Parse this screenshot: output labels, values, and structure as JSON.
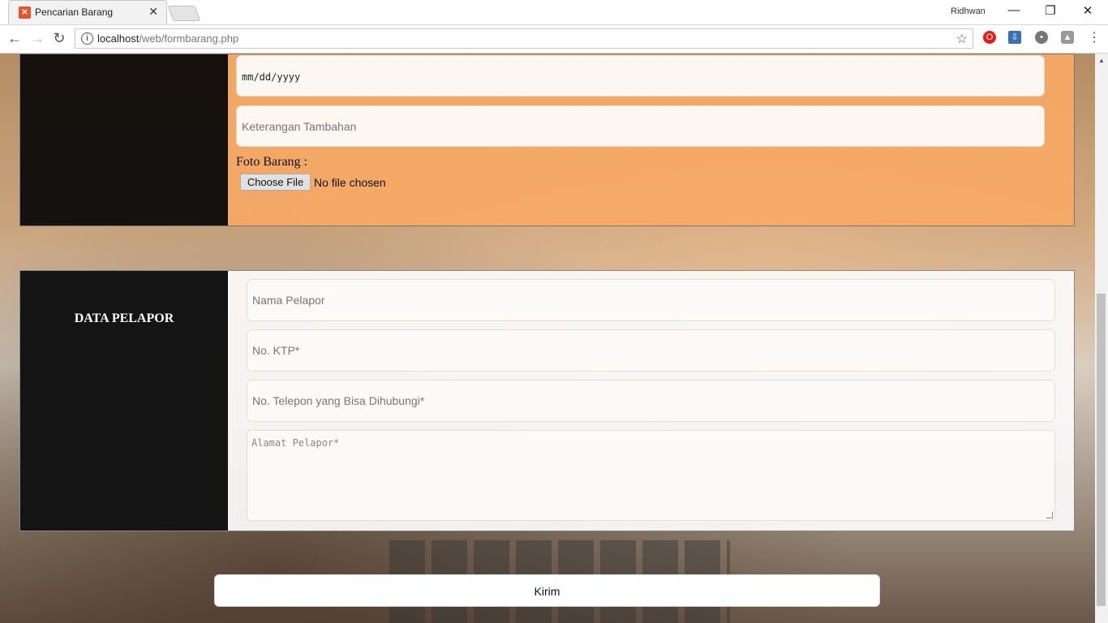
{
  "browser": {
    "tab_title": "Pencarian Barang",
    "profile_name": "Ridhwan",
    "url_host": "localhost",
    "url_path": "/web/formbarang.php"
  },
  "form_barang": {
    "date_placeholder": "mm/dd/yyyy",
    "keterangan_placeholder": "Keterangan Tambahan",
    "foto_label": "Foto Barang :",
    "choose_file_label": "Choose File",
    "no_file_text": "No file chosen"
  },
  "data_pelapor": {
    "title": "DATA PELAPOR",
    "nama_placeholder": "Nama Pelapor",
    "ktp_placeholder": "No. KTP*",
    "telepon_placeholder": "No. Telepon yang Bisa Dihubungi*",
    "alamat_placeholder": "Alamat Pelapor*"
  },
  "submit_label": "Kirim",
  "colors": {
    "orange_panel": "#faa864",
    "dark_panel": "#141414",
    "favicon": "#e8532e"
  }
}
